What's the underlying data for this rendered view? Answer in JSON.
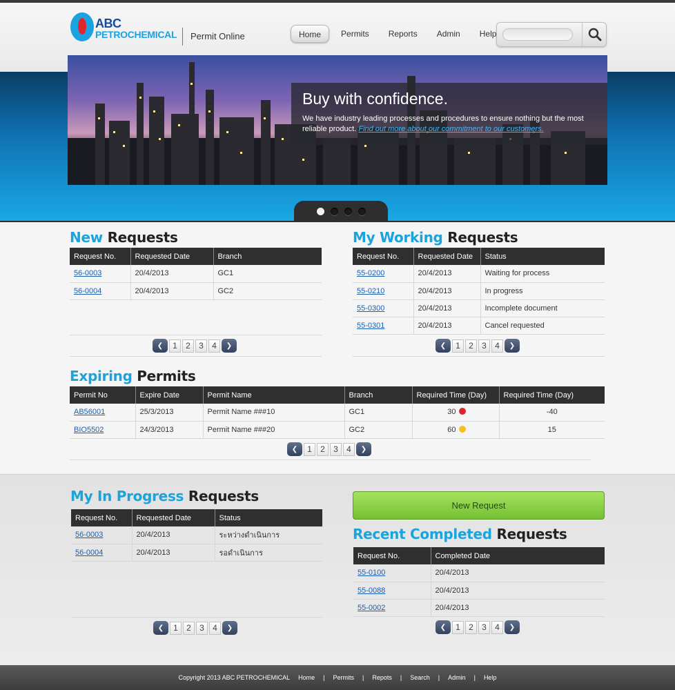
{
  "header": {
    "logo_line1": "ABC",
    "logo_line2": "PETROCHEMICAL",
    "app_title": "Permit Online",
    "nav": [
      "Home",
      "Permits",
      "Reports",
      "Admin",
      "Help"
    ],
    "active_nav": "Home",
    "search_placeholder": ""
  },
  "banner": {
    "title": "Buy with confidence.",
    "text": "We have industry leading processes and procedures to ensure nothing but the most reliable product.",
    "link": "Find out more about our commitment to our customers.",
    "slides": 4,
    "active_slide": 1
  },
  "new_requests": {
    "title_highlight": "New",
    "title_rest": "Requests",
    "columns": [
      "Request No.",
      "Requested Date",
      "Branch"
    ],
    "rows": [
      [
        "56-0003",
        "20/4/2013",
        "GC1"
      ],
      [
        "56-0004",
        "20/4/2013",
        "GC2"
      ]
    ],
    "pages": [
      "1",
      "2",
      "3",
      "4"
    ]
  },
  "my_working": {
    "title_highlight": "My Working",
    "title_rest": "Requests",
    "columns": [
      "Request No.",
      "Requested Date",
      "Status"
    ],
    "rows": [
      [
        "55-0200",
        "20/4/2013",
        "Waiting for process"
      ],
      [
        "55-0210",
        "20/4/2013",
        "In progress"
      ],
      [
        "55-0300",
        "20/4/2013",
        "Incomplete document"
      ],
      [
        "55-0301",
        "20/4/2013",
        "Cancel requested"
      ]
    ],
    "pages": [
      "1",
      "2",
      "3",
      "4"
    ]
  },
  "expiring": {
    "title_highlight": "Expiring",
    "title_rest": "Permits",
    "columns": [
      "Permit No",
      "Expire Date",
      "Permit Name",
      "Branch",
      "Required Time (Day)",
      "Required Time (Day)"
    ],
    "rows": [
      {
        "permit_no": "AB56001",
        "expire": "25/3/2013",
        "name": "Permit Name ###10",
        "branch": "GC1",
        "required": "30",
        "status_color": "#d9262a",
        "remaining": "-40"
      },
      {
        "permit_no": "BIO5502",
        "expire": "24/3/2013",
        "name": "Permit Name ###20",
        "branch": "GC2",
        "required": "60",
        "status_color": "#f2c21a",
        "remaining": "15"
      }
    ],
    "pages": [
      "1",
      "2",
      "3",
      "4"
    ]
  },
  "in_progress": {
    "title_highlight": "My In Progress",
    "title_rest": "Requests",
    "columns": [
      "Request No.",
      "Requested Date",
      "Status"
    ],
    "rows": [
      [
        "56-0003",
        "20/4/2013",
        "ระหว่างดำเนินการ"
      ],
      [
        "56-0004",
        "20/4/2013",
        "รอดำเนินการ"
      ]
    ],
    "pages": [
      "1",
      "2",
      "3",
      "4"
    ]
  },
  "new_request_button": "New Request",
  "recent_completed": {
    "title_highlight": "Recent Completed",
    "title_rest": "Requests",
    "columns": [
      "Request No.",
      "Completed Date"
    ],
    "rows": [
      [
        "55-0100",
        "20/4/2013"
      ],
      [
        "55-0088",
        "20/4/2013"
      ],
      [
        "55-0002",
        "20/4/2013"
      ]
    ],
    "pages": [
      "1",
      "2",
      "3",
      "4"
    ]
  },
  "footer": {
    "copyright": "Copyright 2013 ABC PETROCHEMICAL",
    "links": [
      "Home",
      "Permits",
      "Repots",
      "Search",
      "Admin",
      "Help"
    ]
  }
}
